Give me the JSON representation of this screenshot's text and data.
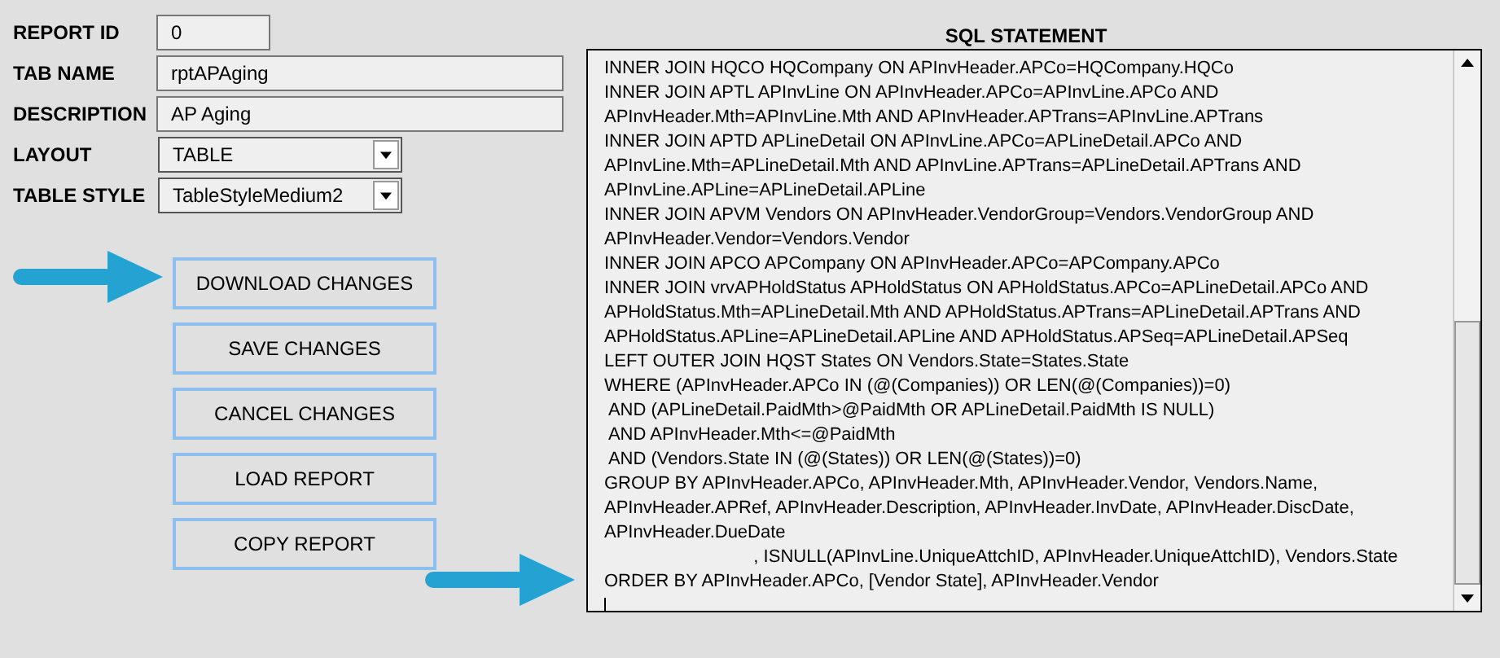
{
  "fields": [
    {
      "label": "REPORT ID",
      "value": "0",
      "kind": "short"
    },
    {
      "label": "TAB NAME",
      "value": "rptAPAging",
      "kind": "text"
    },
    {
      "label": "DESCRIPTION",
      "value": "AP Aging",
      "kind": "text"
    },
    {
      "label": "LAYOUT",
      "value": "TABLE",
      "kind": "select"
    },
    {
      "label": "TABLE STYLE",
      "value": "TableStyleMedium2",
      "kind": "select"
    }
  ],
  "buttons": [
    "DOWNLOAD CHANGES",
    "SAVE CHANGES",
    "CANCEL CHANGES",
    "LOAD REPORT",
    "COPY REPORT"
  ],
  "sql": {
    "title": "SQL STATEMENT",
    "lines": [
      "INNER JOIN HQCO HQCompany ON APInvHeader.APCo=HQCompany.HQCo",
      "INNER JOIN APTL APInvLine ON APInvHeader.APCo=APInvLine.APCo AND",
      "APInvHeader.Mth=APInvLine.Mth AND APInvHeader.APTrans=APInvLine.APTrans",
      "INNER JOIN APTD APLineDetail ON APInvLine.APCo=APLineDetail.APCo AND",
      "APInvLine.Mth=APLineDetail.Mth AND APInvLine.APTrans=APLineDetail.APTrans AND",
      "APInvLine.APLine=APLineDetail.APLine",
      "INNER JOIN APVM Vendors ON APInvHeader.VendorGroup=Vendors.VendorGroup AND",
      "APInvHeader.Vendor=Vendors.Vendor",
      "INNER JOIN APCO APCompany ON APInvHeader.APCo=APCompany.APCo",
      "INNER JOIN vrvAPHoldStatus APHoldStatus ON APHoldStatus.APCo=APLineDetail.APCo AND",
      "APHoldStatus.Mth=APLineDetail.Mth AND APHoldStatus.APTrans=APLineDetail.APTrans AND",
      "APHoldStatus.APLine=APLineDetail.APLine AND APHoldStatus.APSeq=APLineDetail.APSeq",
      "LEFT OUTER JOIN HQST States ON Vendors.State=States.State",
      "WHERE (APInvHeader.APCo IN (@(Companies)) OR LEN(@(Companies))=0)",
      " AND (APLineDetail.PaidMth>@PaidMth OR APLineDetail.PaidMth IS NULL)",
      " AND APInvHeader.Mth<=@PaidMth",
      " AND (Vendors.State IN (@(States)) OR LEN(@(States))=0)",
      "GROUP BY APInvHeader.APCo, APInvHeader.Mth, APInvHeader.Vendor, Vendors.Name,",
      "APInvHeader.APRef, APInvHeader.Description, APInvHeader.InvDate, APInvHeader.DiscDate,",
      "APInvHeader.DueDate",
      "                              , ISNULL(APInvLine.UniqueAttchID, APInvHeader.UniqueAttchID), Vendors.State",
      "ORDER BY APInvHeader.APCo, [Vendor State], APInvHeader.Vendor"
    ]
  }
}
